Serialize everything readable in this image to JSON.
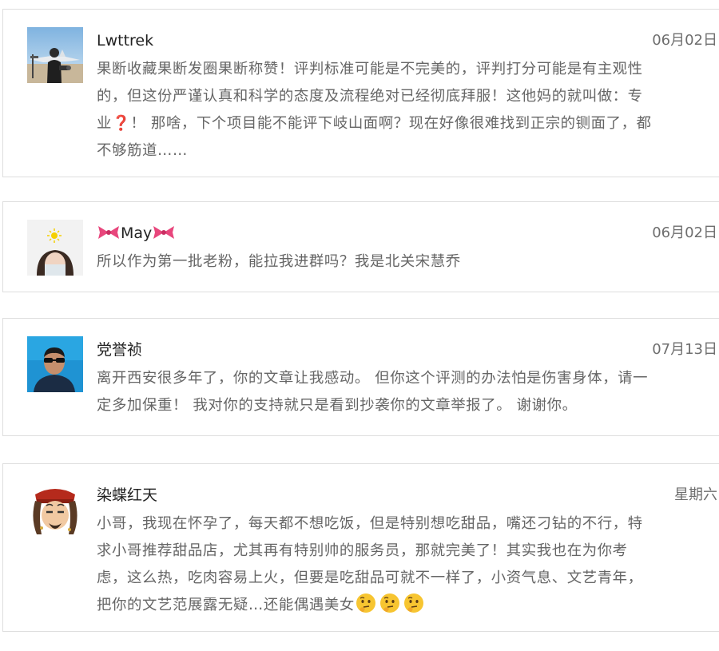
{
  "comments": [
    {
      "user": "Lwttrek",
      "date": "06月02日",
      "text_part1": "果断收藏果断发圈果断称赞！评判标准可能是不完美的，评判打分可能是有主观性的，但这份严谨认真和科学的态度及流程绝对已经彻底拜服！这他妈的就叫做：专业",
      "qmark": "❓",
      "text_part2": "！ 那啥，下个项目能不能评下岐山面啊？现在好像很难找到正宗的铡面了，都不够筋道……"
    },
    {
      "user": "May",
      "name_decoration_icon": "ribbon-bow-icon",
      "date": "06月02日",
      "text": "所以作为第一批老粉，能拉我进群吗？我是北关宋慧乔"
    },
    {
      "user": "党誉祯",
      "date": "07月13日",
      "text": "离开西安很多年了，你的文章让我感动。 但你这个评测的办法怕是伤害身体，请一定多加保重！ 我对你的支持就只是看到抄袭你的文章举报了。 谢谢你。"
    },
    {
      "user": "染蝶红天",
      "date": "星期六",
      "text": "小哥，我现在怀孕了，每天都不想吃饭，但是特别想吃甜品，嘴还刁钻的不行，特求小哥推荐甜品店，尤其再有特别帅的服务员，那就完美了！其实我也在为你考虑，这么热，吃肉容易上火，但要是吃甜品可就不一样了，小资气息、文艺青年，把你的文艺范展露无疑…还能偶遇美女",
      "trailing_icons": [
        "thinking-face-emoji",
        "thinking-face-emoji",
        "thinking-face-emoji"
      ]
    }
  ],
  "colors": {
    "name": "#222222",
    "date": "#6e6e6e",
    "body": "#666666",
    "border": "#dedede",
    "question_mark": "#d8232a",
    "ribbon": "#e8467c"
  }
}
